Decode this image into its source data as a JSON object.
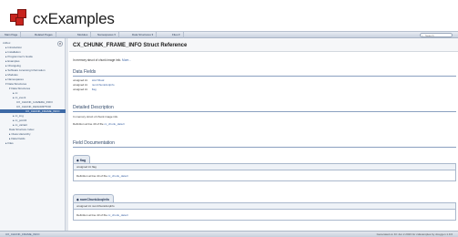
{
  "header": {
    "app_title": "cxExamples"
  },
  "navbar": {
    "items": [
      {
        "label": "Main Page"
      },
      {
        "label": "Related Pages"
      },
      {
        "label": "Modules"
      },
      {
        "label": "Namespaces ▾"
      },
      {
        "label": "Data Structures ▾"
      },
      {
        "label": "Files ▾"
      }
    ],
    "search_placeholder": "Search"
  },
  "sidebar": {
    "items": [
      {
        "label": "cxDoc"
      },
      {
        "label": "▸ Introduction"
      },
      {
        "label": "▸ Installation"
      },
      {
        "label": "▸ Programmer's Guide"
      },
      {
        "label": "▸ Examples"
      },
      {
        "label": "▸ Changelog"
      },
      {
        "label": "▸ Software Licensing Information"
      },
      {
        "label": "▸ Modules"
      },
      {
        "label": "▸ Namespaces"
      },
      {
        "label": "▾ Data Structures"
      },
      {
        "label": "▾ Data Structures"
      },
      {
        "label": "▸ cx"
      },
      {
        "label": "▸ cx_event"
      },
      {
        "label": "CX_CHUNK_CAMERA_INFO"
      },
      {
        "label": "CX_CHUNK_DESCRIPTOR"
      },
      {
        "label": "CX_CHUNK_FRAME_INFO"
      },
      {
        "label": "▸ cx_img"
      },
      {
        "label": "▸ cx_point3"
      },
      {
        "label": "▸ cx_variant"
      },
      {
        "label": "Data Structure Index"
      },
      {
        "label": "▸ Class Hierarchy"
      },
      {
        "label": "▸ Data Fields"
      },
      {
        "label": "▸ Files"
      }
    ]
  },
  "content": {
    "title": "CX_CHUNK_FRAME_INFO Struct Reference",
    "brief": "In memory struct of chunk image info.",
    "brief_more": "More...",
    "data_fields_heading": "Data Fields",
    "fields": [
      {
        "type": "unsigned int",
        "name": "sizeYReal"
      },
      {
        "type": "unsigned int",
        "name": "numChunkAcqInfo"
      },
      {
        "type": "unsigned int",
        "name": "flag"
      }
    ],
    "detailed_heading": "Detailed Description",
    "detailed_text": "In memory struct of chunk image info.",
    "detailed_def_prefix": "Definition at line 40 of file",
    "detailed_def_file": "cx_chunk_data.h",
    "field_doc_heading": "Field Documentation",
    "members": [
      {
        "anchor": "◆ flag",
        "proto": "unsigned int flag",
        "def_prefix": "Definition at line 44 of file",
        "def_file": "cx_chunk_data.h"
      },
      {
        "anchor": "◆ numChunkAcqInfo",
        "proto": "unsigned int numChunkAcqInfo",
        "def_prefix": "Definition at line 43 of file",
        "def_file": "cx_chunk_data.h"
      }
    ]
  },
  "footer": {
    "crumb": "CX_CHUNK_FRAME_INFO",
    "generated": "Generated on Fri Jun 2 2023 for cxExamples by doxygen 1.9.6"
  },
  "colors": {
    "accent": "#3e6aa6",
    "logo": "#c8241e",
    "link": "#3b62a3"
  }
}
